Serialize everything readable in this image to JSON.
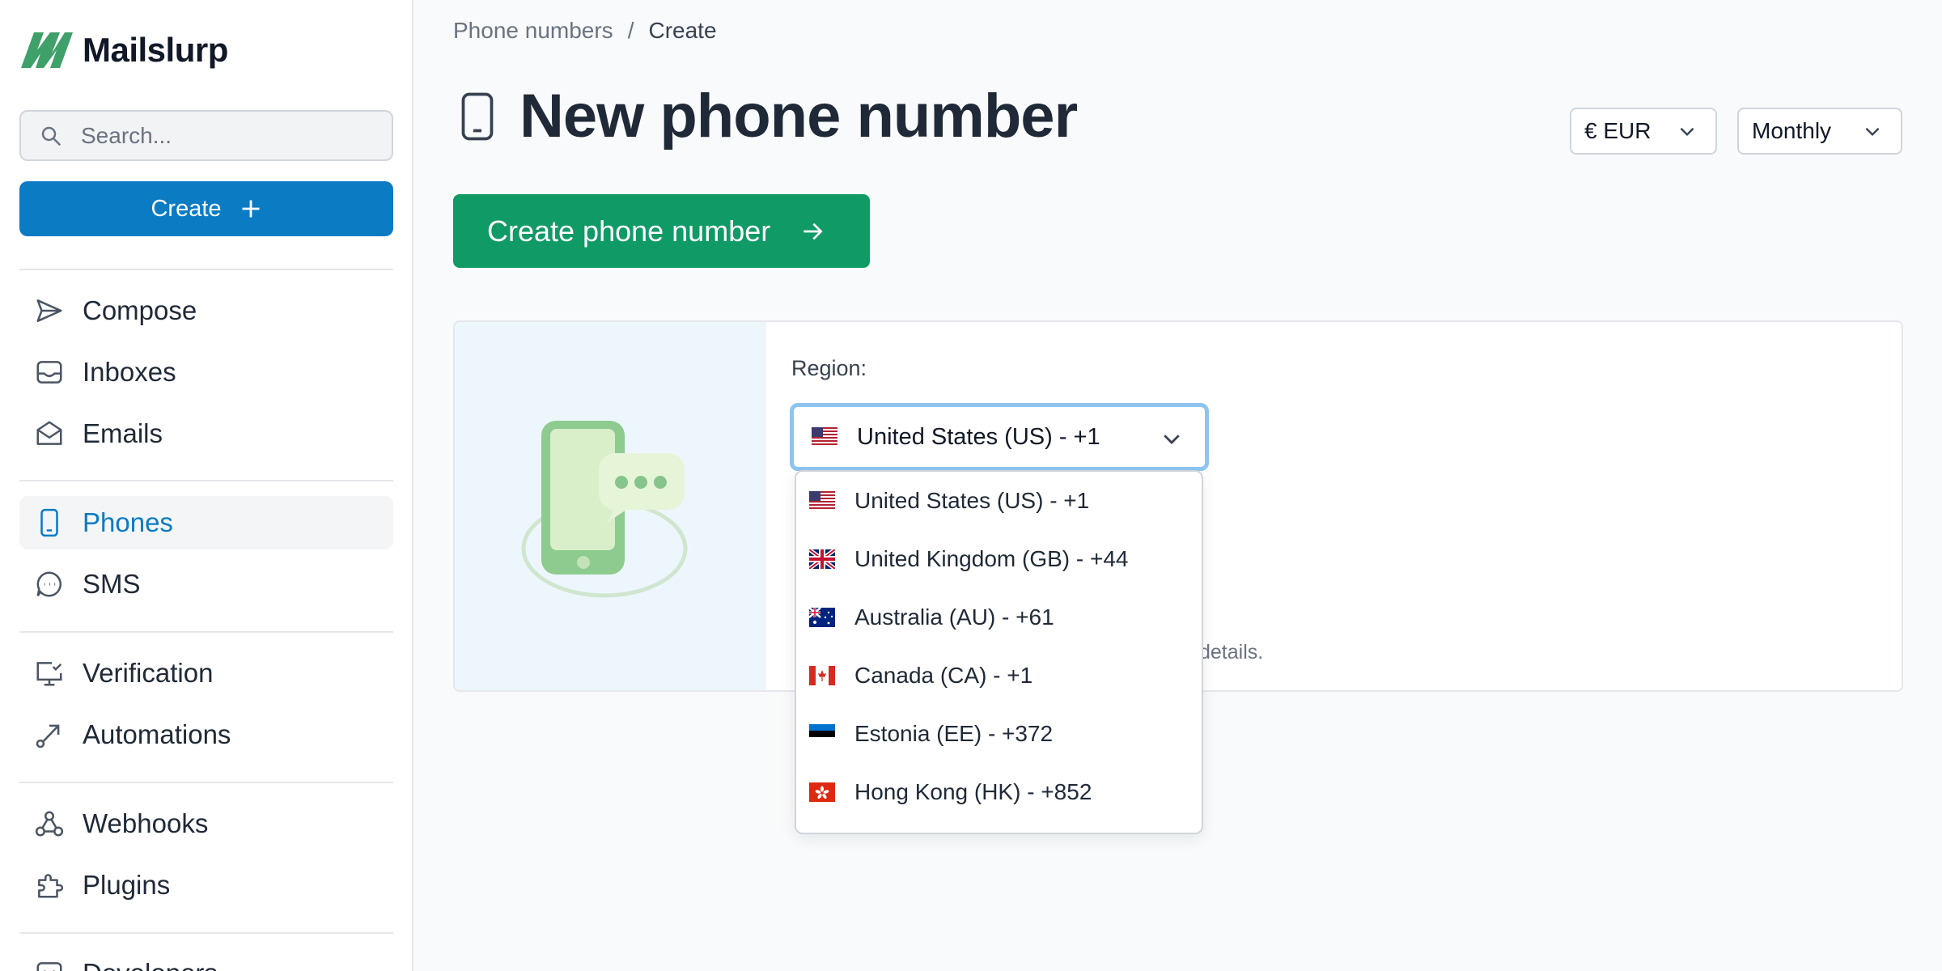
{
  "brand": {
    "name": "Mailslurp",
    "accent": "#0b7bc4",
    "logo_green": "#3fa06a"
  },
  "search": {
    "placeholder": "Search..."
  },
  "sidebar": {
    "create_label": "Create",
    "items": [
      {
        "label": "Compose",
        "icon": "send-icon"
      },
      {
        "label": "Inboxes",
        "icon": "inbox-icon"
      },
      {
        "label": "Emails",
        "icon": "envelope-icon"
      },
      {
        "label": "Phones",
        "icon": "phone-icon",
        "active": true
      },
      {
        "label": "SMS",
        "icon": "chat-icon"
      },
      {
        "label": "Verification",
        "icon": "monitor-check-icon"
      },
      {
        "label": "Automations",
        "icon": "route-icon"
      },
      {
        "label": "Webhooks",
        "icon": "webhook-icon"
      },
      {
        "label": "Plugins",
        "icon": "puzzle-icon"
      },
      {
        "label": "Developers",
        "icon": "code-icon"
      }
    ]
  },
  "breadcrumb": {
    "parent": "Phone numbers",
    "separator": "/",
    "current": "Create"
  },
  "header": {
    "title": "New phone number",
    "currency": "€ EUR",
    "billing_period": "Monthly"
  },
  "actions": {
    "create_label": "Create phone number",
    "primary_color": "#0f9a66"
  },
  "form": {
    "region_label": "Region:",
    "selected_region": "United States (US) - +1",
    "hint_fragment": "details.",
    "options": [
      {
        "label": "United States (US) - +1",
        "flag": "us-flag-icon"
      },
      {
        "label": "United Kingdom (GB) - +44",
        "flag": "gb-flag-icon"
      },
      {
        "label": "Australia (AU) - +61",
        "flag": "au-flag-icon"
      },
      {
        "label": "Canada (CA) - +1",
        "flag": "ca-flag-icon"
      },
      {
        "label": "Estonia (EE) - +372",
        "flag": "ee-flag-icon"
      },
      {
        "label": "Hong Kong (HK) - +852",
        "flag": "hk-flag-icon"
      }
    ]
  }
}
